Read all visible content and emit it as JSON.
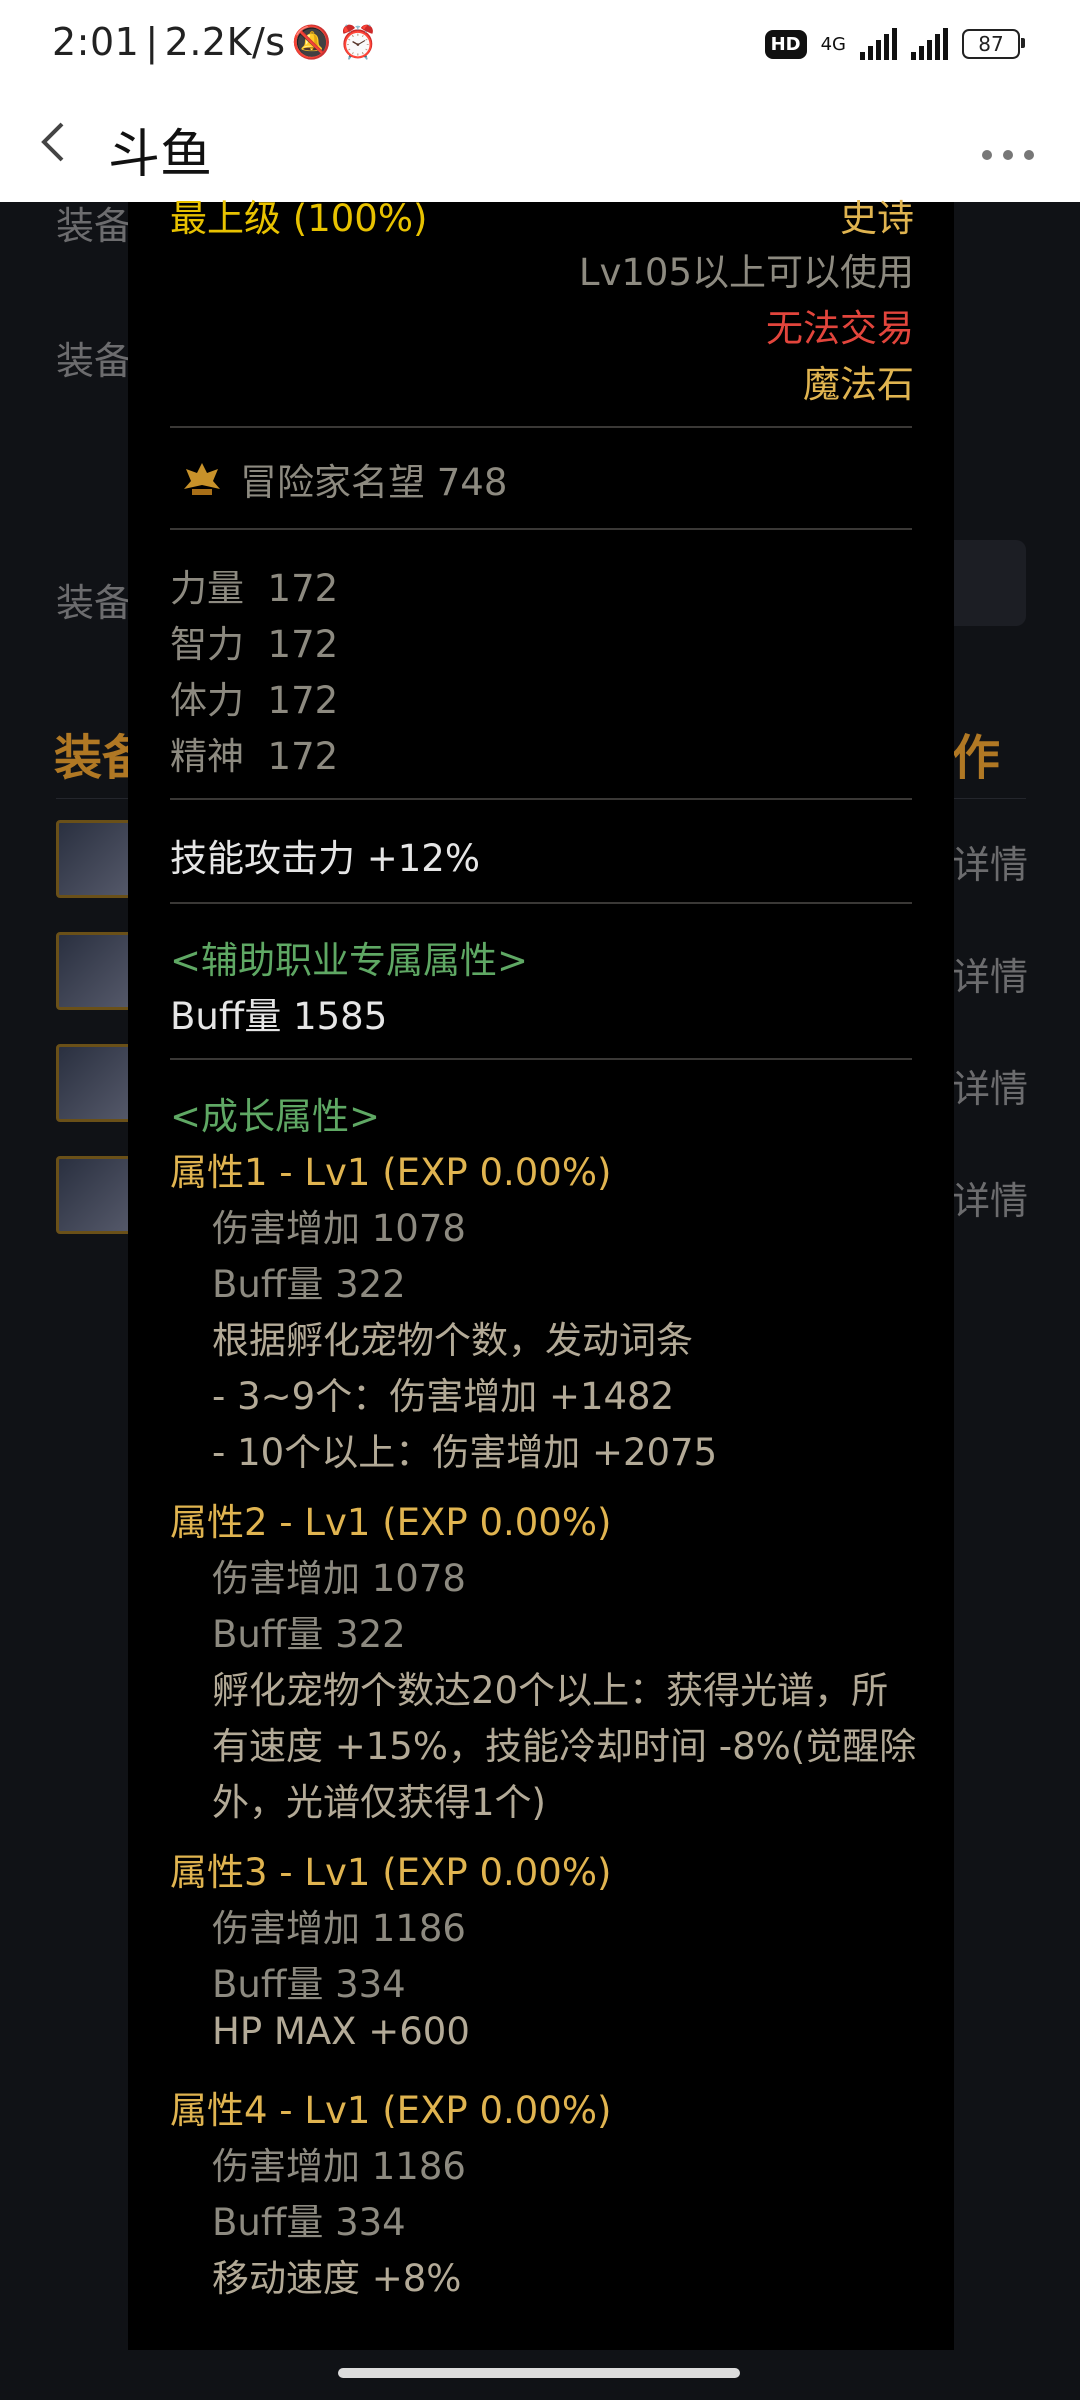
{
  "status_bar": {
    "time": "2:01",
    "speed": "2.2K/s",
    "hd": "HD",
    "network": "4G",
    "battery": "87"
  },
  "header": {
    "title": "斗鱼"
  },
  "background": {
    "label_1": "装备",
    "label_2": "装备",
    "label_3": "装备",
    "section_left": "装备",
    "section_right": "作",
    "detail": "详情"
  },
  "tooltip": {
    "grade": "最上级 (100%)",
    "rarity": "史诗",
    "level_req": "Lv105以上可以使用",
    "trade": "无法交易",
    "type": "魔法石",
    "adventurer_fame": "冒险家名望 748",
    "stats": [
      {
        "name": "力量",
        "value": "172"
      },
      {
        "name": "智力",
        "value": "172"
      },
      {
        "name": "体力",
        "value": "172"
      },
      {
        "name": "精神",
        "value": "172"
      }
    ],
    "skill_attack": "技能攻击力  +12%",
    "support_header": "<辅助职业专属属性>",
    "buff_amount": "Buff量   1585",
    "growth_header": "<成长属性>",
    "growth": [
      {
        "title": "属性1 - Lv1 (EXP 0.00%)",
        "dmg": "伤害增加   1078",
        "buff": "Buff量   322",
        "effect_lines": [
          "根据孵化宠物个数，发动词条",
          "- 3~9个：伤害增加 +1482",
          "- 10个以上：伤害增加 +2075"
        ]
      },
      {
        "title": "属性2 - Lv1 (EXP 0.00%)",
        "dmg": "伤害增加   1078",
        "buff": "Buff量   322",
        "effect_lines": [
          "孵化宠物个数达20个以上：获得光谱，所",
          "有速度 +15%，技能冷却时间 -8%(觉醒除",
          "外，光谱仅获得1个)"
        ]
      },
      {
        "title": "属性3 - Lv1 (EXP 0.00%)",
        "dmg": "伤害增加   1186",
        "buff": "Buff量   334",
        "effect_lines": [
          "HP MAX +600"
        ]
      },
      {
        "title": "属性4 - Lv1 (EXP 0.00%)",
        "dmg": "伤害增加   1186",
        "buff": "Buff量   334",
        "effect_lines": [
          "移动速度 +8%"
        ]
      }
    ]
  }
}
